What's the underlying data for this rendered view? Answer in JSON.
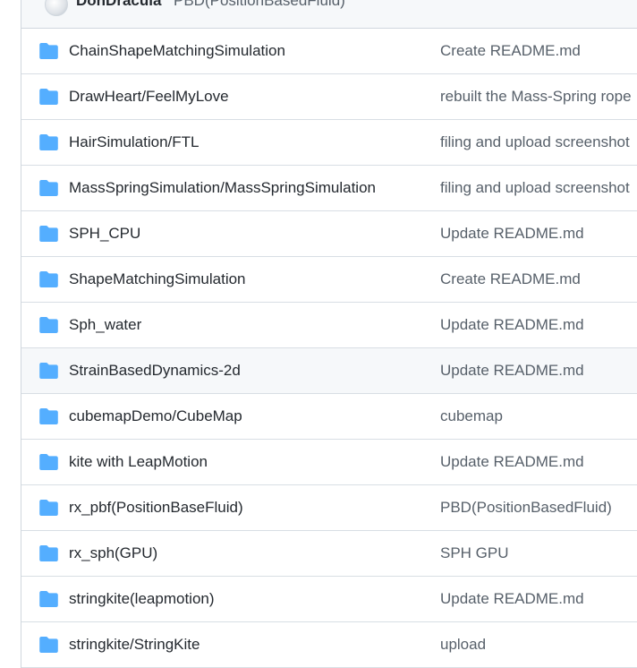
{
  "header": {
    "author": "DonDracula",
    "commit_message": "PBD(PositionBasedFluid)"
  },
  "files": [
    {
      "name": "ChainShapeMatchingSimulation",
      "message": "Create README.md"
    },
    {
      "name": "DrawHeart/FeelMyLove",
      "message": "rebuilt the Mass-Spring rope"
    },
    {
      "name": "HairSimulation/FTL",
      "message": "filing and upload screenshot"
    },
    {
      "name": "MassSpringSimulation/MassSpringSimulation",
      "message": "filing and upload screenshot"
    },
    {
      "name": "SPH_CPU",
      "message": "Update README.md"
    },
    {
      "name": "ShapeMatchingSimulation",
      "message": "Create README.md"
    },
    {
      "name": "Sph_water",
      "message": "Update README.md"
    },
    {
      "name": "StrainBasedDynamics-2d",
      "message": "Update README.md"
    },
    {
      "name": "cubemapDemo/CubeMap",
      "message": "cubemap"
    },
    {
      "name": "kite with LeapMotion",
      "message": "Update README.md"
    },
    {
      "name": "rx_pbf(PositionBaseFluid)",
      "message": "PBD(PositionBasedFluid)"
    },
    {
      "name": "rx_sph(GPU)",
      "message": "SPH GPU"
    },
    {
      "name": "stringkite(leapmotion)",
      "message": "Update README.md"
    },
    {
      "name": "stringkite/StringKite",
      "message": "upload"
    }
  ],
  "icons": {
    "folder": "folder-icon",
    "avatar": "avatar"
  },
  "colors": {
    "folder": "#54aeff",
    "border": "#d0d7de",
    "text": "#24292f",
    "muted": "#57606a",
    "hover_row": "#f6f8fa"
  }
}
